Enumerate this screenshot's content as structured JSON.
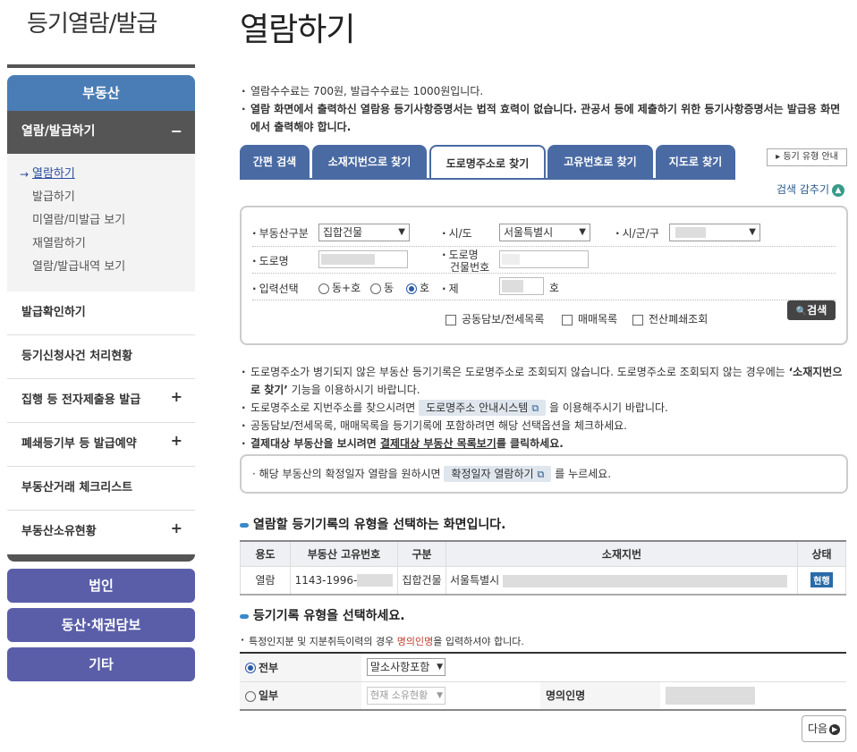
{
  "sidebar": {
    "title": "등기열람/발급",
    "section_realestate": "부동산",
    "group_view_issue": "열람/발급하기",
    "group_view_issue_toggle": "−",
    "sub_items": [
      {
        "label": "열람하기",
        "active": true
      },
      {
        "label": "발급하기",
        "active": false
      },
      {
        "label": "미열람/미발급 보기",
        "active": false
      },
      {
        "label": "재열람하기",
        "active": false
      },
      {
        "label": "열람/발급내역 보기",
        "active": false
      }
    ],
    "menus": [
      {
        "label": "발급확인하기",
        "toggle": ""
      },
      {
        "label": "등기신청사건 처리현황",
        "toggle": ""
      },
      {
        "label": "집행 등 전자제출용 발급",
        "toggle": "+"
      },
      {
        "label": "폐쇄등기부 등 발급예약",
        "toggle": "+"
      },
      {
        "label": "부동산거래 체크리스트",
        "toggle": ""
      },
      {
        "label": "부동산소유현황",
        "toggle": "+"
      }
    ],
    "bottom_buttons": [
      "법인",
      "동산·채권담보",
      "기타"
    ]
  },
  "main": {
    "page_title": "열람하기",
    "notices": [
      "열람수수료는 700원, 발급수수료는 1000원입니다.",
      "열람 화면에서 출력하신 열람용 등기사항증명서는 법적 효력이 없습니다. 관공서 등에 제출하기 위한 등기사항증명서는 발급용 화면에서 출력해야 합니다."
    ],
    "tabs": [
      "간편 검색",
      "소재지번으로 찾기",
      "도로명주소로 찾기",
      "고유번호로 찾기",
      "지도로 찾기"
    ],
    "active_tab": "도로명주소로 찾기",
    "type_guide_button": "등기 유형 안내",
    "collapse_label": "검색 감추기",
    "collapse_icon": "▲",
    "form": {
      "property_type_label": "부동산구분",
      "property_type_value": "집합건물",
      "sido_label": "시/도",
      "sido_value": "서울특별시",
      "sigungu_label": "시/군/구",
      "road_label": "도로명",
      "building_no_label_1": "도로명",
      "building_no_label_2": "건물번호",
      "input_choice_label": "입력선택",
      "radio_options": [
        "동+호",
        "동",
        "호"
      ],
      "radio_selected": "호",
      "unit_label": "제",
      "unit_suffix": "호",
      "checkboxes": [
        "공동담보/전세목록",
        "매매목록",
        "전산폐쇄조회"
      ],
      "search_button": "검색",
      "search_icon": "🔍"
    },
    "info": {
      "line1_a": "도로명주소가 병기되지 않은 부동산 등기기록은 도로명주소로 조회되지 않습니다. 도로명주소로 조회되지 않는 경우에는 ",
      "line1_b": "‘소재지번으로 찾기’",
      "line1_c": " 기능을 이용하시기 바랍니다.",
      "line2_a": "도로명주소로 지번주소를 찾으시려면 ",
      "line2_pill": "도로명주소 안내시스템",
      "line2_b": " 을 이용해주시기 바랍니다.",
      "line3": "공동담보/전세목록, 매매목록을 등기기록에 포함하려면 해당 선택옵션을 체크하세요.",
      "line4_a": "결제대상 부동산을 보시려면 ",
      "line4_link": "결제대상 부동산 목록보기",
      "line4_b": "를 클릭하세요.",
      "external_icon": "⧉"
    },
    "date_box": {
      "text_a": "해당 부동산의 확정일자 열람을 원하시면 ",
      "pill": "확정일자 열람하기",
      "text_b": " 를 누르세요."
    },
    "section1_title": "열람할 등기기록의 유형을 선택하는 화면입니다.",
    "record_table": {
      "headers": [
        "용도",
        "부동산 고유번호",
        "구분",
        "소재지번",
        "상태"
      ],
      "row": {
        "use": "열람",
        "unique_no": "1143-1996-",
        "type": "집합건물",
        "address": "서울특별시",
        "status": "현행"
      }
    },
    "section2_title": "등기기록 유형을 선택하세요.",
    "record_note_a": "특정인지분 및 지분취득이력의 경우 ",
    "record_note_hl": "명의인명",
    "record_note_b": "을 입력하셔야 합니다.",
    "record_type": {
      "all_label": "전부",
      "all_select": "말소사항포함",
      "part_label": "일부",
      "part_select": "현재 소유현황",
      "owner_label": "명의인명"
    },
    "next_button": "다음"
  },
  "colors": {
    "sidebar_blue": "#4a7db5",
    "sidebar_dark": "#555555",
    "sidebar_purple": "#5a5ea9",
    "tab_blue": "#4a6aa3",
    "status_badge": "#2a6aa8"
  }
}
